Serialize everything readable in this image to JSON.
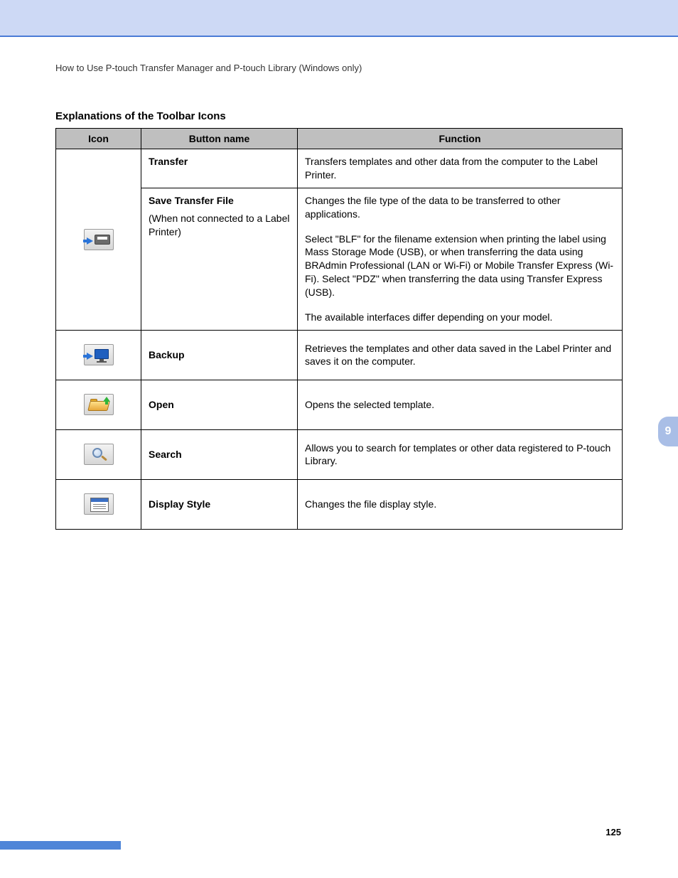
{
  "header": {
    "breadcrumb": "How to Use P-touch Transfer Manager and P-touch Library (Windows only)"
  },
  "section": {
    "title": "Explanations of the Toolbar Icons"
  },
  "table": {
    "head": {
      "c1": "Icon",
      "c2": "Button name",
      "c3": "Function"
    },
    "rows": {
      "transfer": {
        "name": "Transfer",
        "func": "Transfers templates and other data from the computer to the Label Printer."
      },
      "save": {
        "name": "Save Transfer File",
        "note": "(When not connected to a Label Printer)",
        "func1": "Changes the file type of the data to be transferred to other applications.",
        "func2": "Select \"BLF\" for the filename extension when printing the label using Mass Storage Mode (USB), or when transferring the data using BRAdmin Professional (LAN or Wi-Fi) or Mobile Transfer Express (Wi-Fi).  Select \"PDZ\" when transferring the data using Transfer Express (USB).",
        "func3": "The available interfaces differ depending on your model."
      },
      "backup": {
        "name": "Backup",
        "func": "Retrieves the templates and other data saved in the Label Printer and saves it on the computer."
      },
      "open": {
        "name": "Open",
        "func": "Opens the selected template."
      },
      "search": {
        "name": "Search",
        "func": "Allows you to search for templates or other data registered to P-touch Library."
      },
      "display": {
        "name": "Display Style",
        "func": "Changes the file display style."
      }
    }
  },
  "sideTab": "9",
  "pageNumber": "125"
}
